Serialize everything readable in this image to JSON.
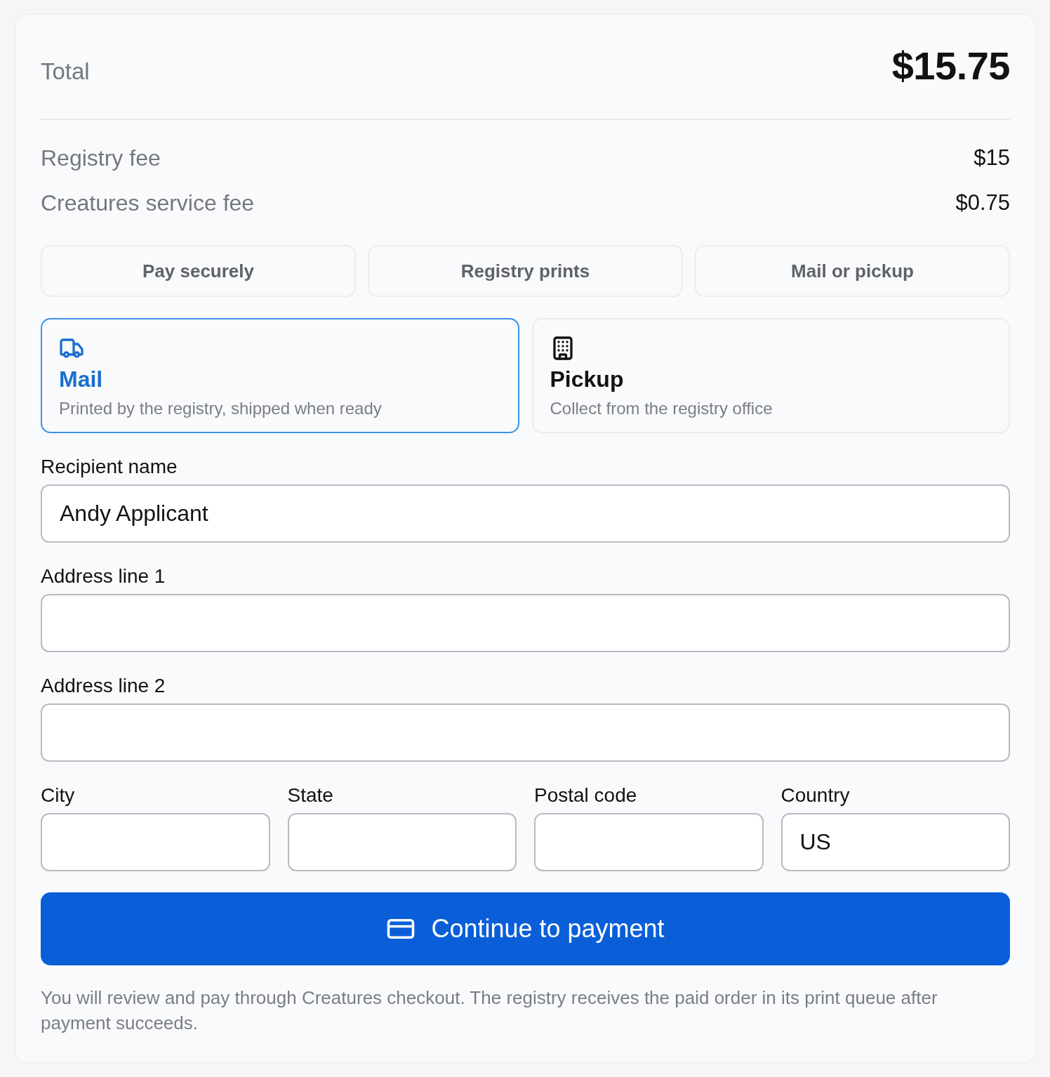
{
  "summary": {
    "total_label": "Total",
    "total_amount": "$15.75",
    "fees": [
      {
        "label": "Registry fee",
        "amount": "$15"
      },
      {
        "label": "Creatures service fee",
        "amount": "$0.75"
      }
    ]
  },
  "steps": [
    {
      "label": "Pay securely"
    },
    {
      "label": "Registry prints"
    },
    {
      "label": "Mail or pickup"
    }
  ],
  "delivery_options": [
    {
      "kind": "mail",
      "title": "Mail",
      "description": "Printed by the registry, shipped when ready",
      "selected": true
    },
    {
      "kind": "pickup",
      "title": "Pickup",
      "description": "Collect from the registry office",
      "selected": false
    }
  ],
  "fields": [
    {
      "label": "Recipient name",
      "value": "Andy Applicant"
    },
    {
      "label": "Address line 1"
    },
    {
      "label": "Address line 2"
    }
  ],
  "address_row": [
    {
      "label": "City"
    },
    {
      "label": "State"
    },
    {
      "label": "Postal code"
    },
    {
      "label": "Country",
      "value": "US"
    }
  ],
  "submit_button": {
    "label": "Continue to payment"
  },
  "note": "You will review and pay through Creatures checkout. The registry receives the paid order in its print queue after payment succeeds."
}
